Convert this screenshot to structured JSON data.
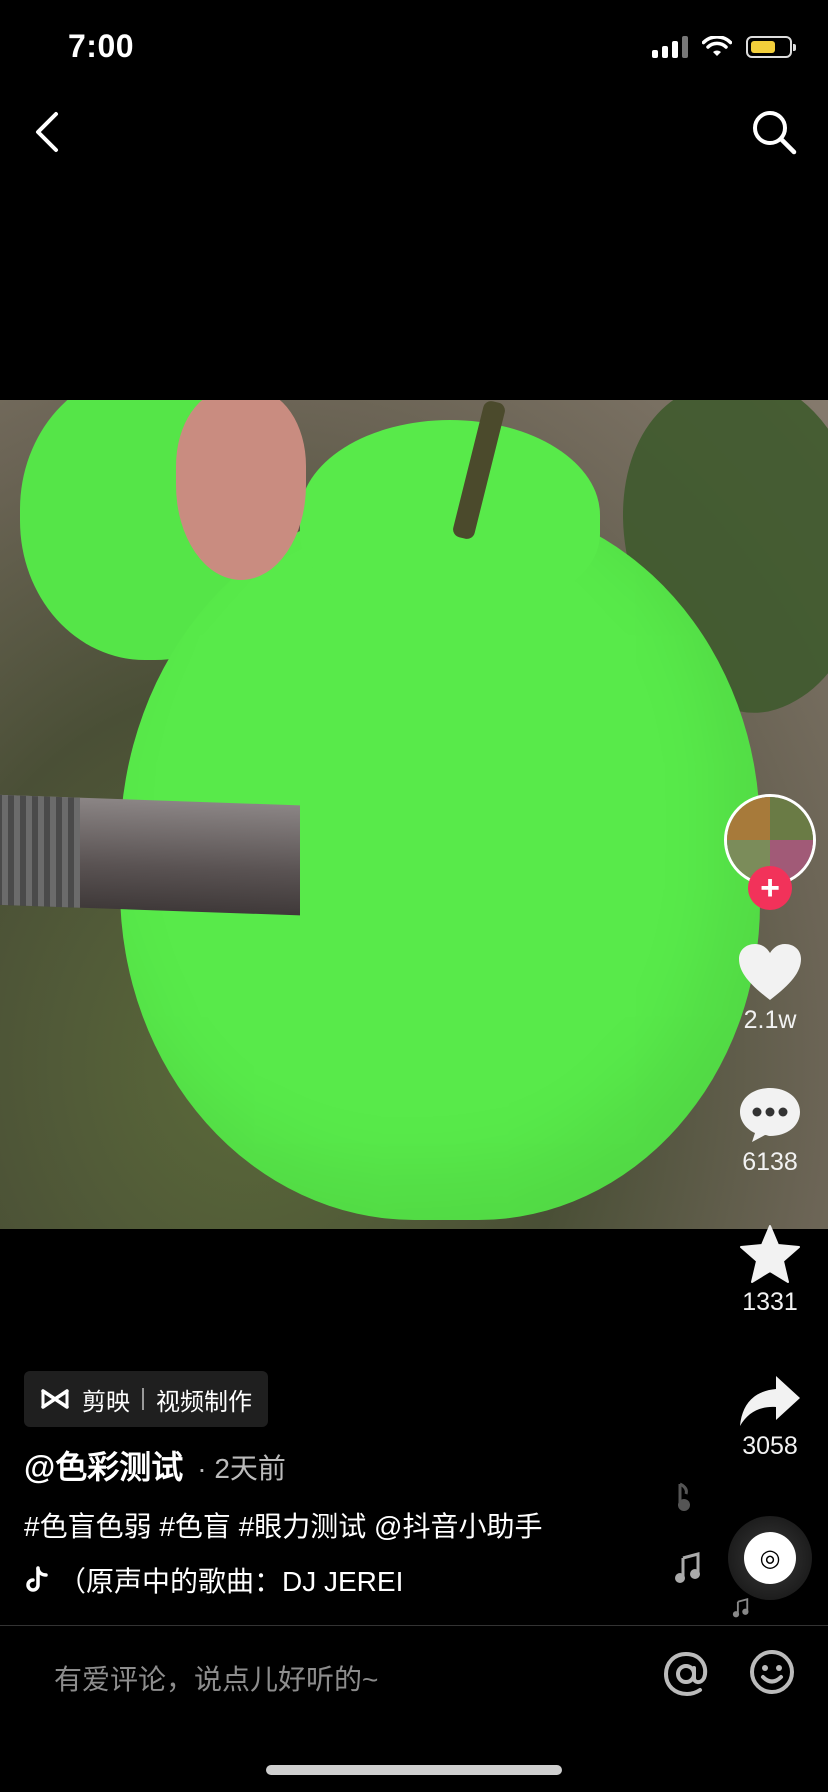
{
  "status_bar": {
    "time": "7:00"
  },
  "video": {
    "accent_color": "#58ea4a"
  },
  "sidebar": {
    "follow_label": "+",
    "like_count": "2.1w",
    "comment_count": "6138",
    "favorite_count": "1331",
    "share_count": "3058"
  },
  "capcut": {
    "app": "剪映",
    "label": "视频制作"
  },
  "post": {
    "username": "@色彩测试",
    "time": "· 2天前",
    "caption": "#色盲色弱 #色盲 #眼力测试 @抖音小助手",
    "music": "（原声中的歌曲：DJ JEREI"
  },
  "comment_bar": {
    "placeholder": "有爱评论，说点儿好听的~"
  },
  "icons": [
    "back-icon",
    "search-icon",
    "heart-icon",
    "comment-icon",
    "star-icon",
    "share-icon",
    "music-note-icon",
    "tiktok-icon",
    "at-icon",
    "emoji-icon"
  ],
  "colors": {
    "follow": "#f2325a",
    "battery": "#f3cf3b"
  }
}
